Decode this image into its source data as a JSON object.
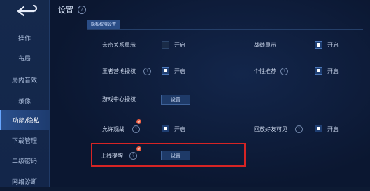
{
  "sidebar": {
    "items": [
      {
        "label": "操作"
      },
      {
        "label": "布局"
      },
      {
        "label": "局内音效"
      },
      {
        "label": "录像"
      },
      {
        "label": "功能/隐私",
        "active": true
      },
      {
        "label": "下载管理"
      },
      {
        "label": "二级密码"
      },
      {
        "label": "网络诊断"
      }
    ]
  },
  "header": {
    "title": "设置"
  },
  "section": {
    "tag": "隐私权限设置"
  },
  "settings": {
    "relation_label": "亲密关系显示",
    "relation_opt": "开启",
    "battle_label": "战绩显示",
    "battle_opt": "开启",
    "camp_label": "王者营地授权",
    "camp_opt": "开启",
    "recommend_label": "个性推荐",
    "recommend_opt": "开启",
    "gamecenter_label": "游戏中心授权",
    "gamecenter_btn": "设置",
    "spectate_label": "允许观战",
    "spectate_opt": "开启",
    "friends_label": "回放好友可见",
    "friends_opt": "开启",
    "online_label": "上线提醒",
    "online_btn": "设置",
    "new_badge": "新"
  },
  "colors": {
    "accent": "#2a4f8c",
    "highlight": "#d62424"
  }
}
